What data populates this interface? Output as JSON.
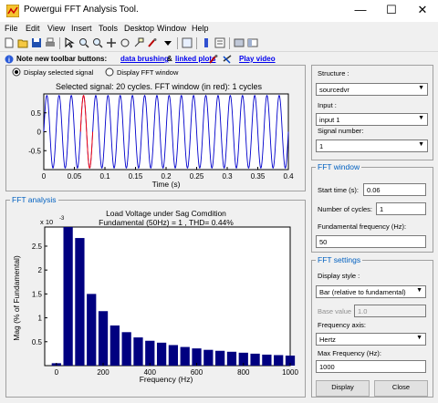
{
  "window": {
    "title": "Powergui FFT Analysis Tool.",
    "minimize": "—",
    "maximize": "☐",
    "close": "✕"
  },
  "menu": [
    "File",
    "Edit",
    "View",
    "Insert",
    "Tools",
    "Desktop",
    "Window",
    "Help"
  ],
  "note": {
    "prefix": "Note new toolbar buttons:",
    "link1": "data brushing",
    "amp": "&",
    "link2": "linked plots",
    "link3": "Play video"
  },
  "signal_panel": {
    "radio_selected": "Display selected signal",
    "radio_fft": "Display FFT window",
    "title": "Selected signal: 20 cycles. FFT window (in red): 1 cycles",
    "xlabel": "Time (s)",
    "xticks": [
      "0",
      "0.05",
      "0.1",
      "0.15",
      "0.2",
      "0.25",
      "0.3",
      "0.35",
      "0.4"
    ],
    "yticks": [
      "0.5",
      "0",
      "-0.5"
    ]
  },
  "fft_panel": {
    "label": "FFT analysis",
    "title1": "Load Voltage under Sag Comdition",
    "title2": "Fundamental (50Hz) = 1 , THD= 0.44%",
    "multiplier": "x 10",
    "exponent": "-3",
    "ylabel": "Mag (% of Fundamental)",
    "xlabel": "Frequency (Hz)",
    "xticks": [
      "0",
      "200",
      "400",
      "600",
      "800",
      "1000"
    ],
    "yticks": [
      "0.5",
      "1",
      "1.5",
      "2",
      "2.5"
    ]
  },
  "chart_data": [
    {
      "type": "line",
      "title": "Selected signal: 20 cycles. FFT window (in red): 1 cycles",
      "xlabel": "Time (s)",
      "ylabel": "",
      "xlim": [
        0,
        0.4
      ],
      "ylim": [
        -1,
        1
      ],
      "series": [
        {
          "name": "signal",
          "amplitude": [
            0.96,
            0.96,
            0.96,
            0.96,
            0.96,
            0.96,
            0.96,
            0.96,
            0.96,
            0.96,
            0.96,
            0.96,
            0.96,
            0.96,
            0.96,
            0.96,
            0.96,
            0.96,
            0.96,
            0.96
          ],
          "frequency_hz": 50,
          "color": "#0000cc"
        },
        {
          "name": "FFT window",
          "t_start": 0.06,
          "t_end": 0.08,
          "color": "#ff0000"
        }
      ]
    },
    {
      "type": "bar",
      "title": "Load Voltage under Sag Comdition",
      "xlabel": "Frequency (Hz)",
      "ylabel": "Mag (% of Fundamental)",
      "xlim": [
        -50,
        1000
      ],
      "ylim": [
        0,
        0.0029
      ],
      "x": [
        0,
        50,
        100,
        150,
        200,
        250,
        300,
        350,
        400,
        450,
        500,
        550,
        600,
        650,
        700,
        750,
        800,
        850,
        900,
        950,
        1000
      ],
      "values": [
        5e-05,
        0.00291,
        0.00267,
        0.0015,
        0.00114,
        0.00084,
        0.0007,
        0.00059,
        0.00052,
        0.00048,
        0.00043,
        0.00039,
        0.00036,
        0.00033,
        0.00031,
        0.00029,
        0.00027,
        0.00025,
        0.00023,
        0.00022,
        0.00021
      ],
      "color": "#000080"
    }
  ],
  "right": {
    "structure_label": "Structure :",
    "structure_value": "sourcedvr",
    "input_label": "Input :",
    "input_value": "input 1",
    "signal_number_label": "Signal number:",
    "signal_number_value": "1",
    "fft_window_title": "FFT window",
    "start_time_label": "Start time (s):",
    "start_time_value": "0.06",
    "cycles_label": "Number of cycles:",
    "cycles_value": "1",
    "fund_freq_label": "Fundamental frequency (Hz):",
    "fund_freq_value": "50",
    "fft_settings_title": "FFT settings",
    "display_style_label": "Display style :",
    "display_style_value": "Bar (relative to fundamental)",
    "base_value_label": "Base value :",
    "base_value_value": "1.0",
    "freq_axis_label": "Frequency axis:",
    "freq_axis_value": "Hertz",
    "max_freq_label": "Max Frequency (Hz):",
    "max_freq_value": "1000",
    "display_button": "Display",
    "close_button": "Close"
  }
}
